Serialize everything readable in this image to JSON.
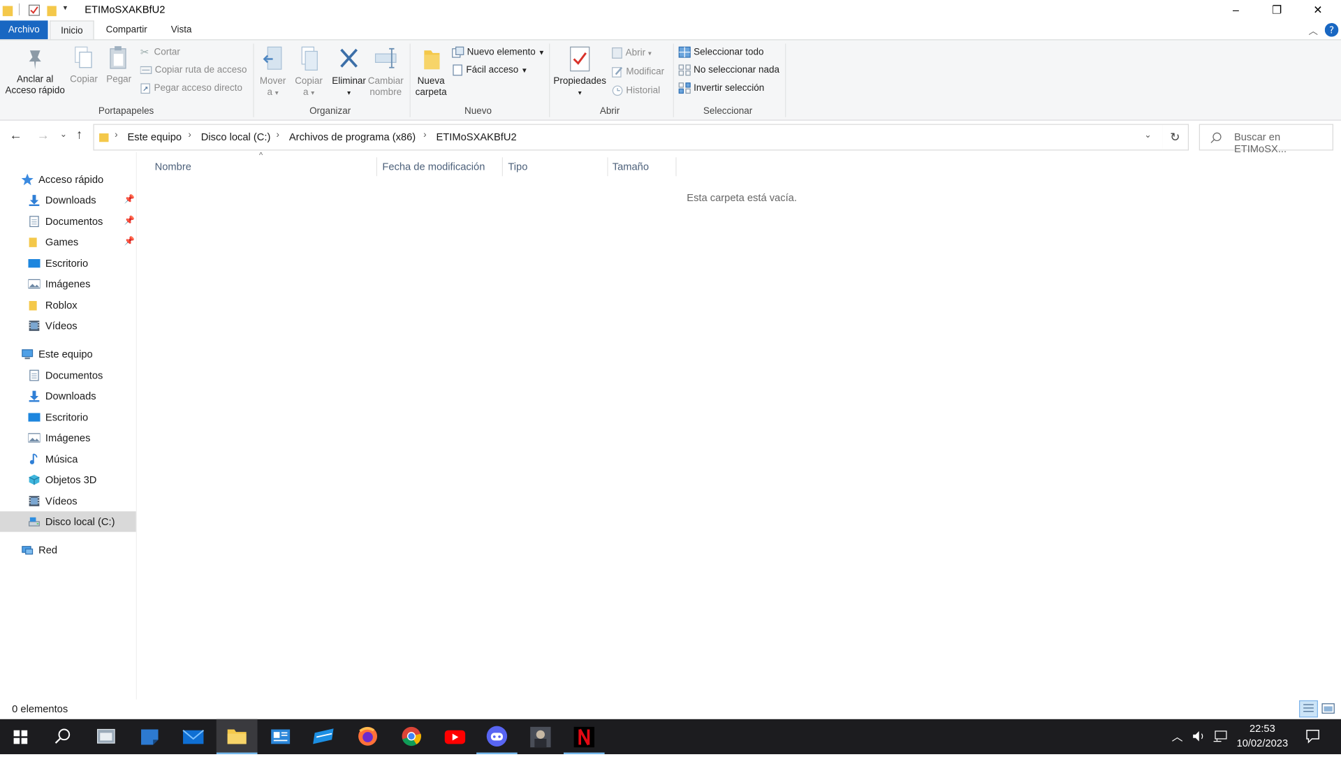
{
  "window": {
    "title": "ETIMoSXAKBfU2",
    "controls": {
      "minimize": "–",
      "maximize": "❐",
      "close": "✕"
    }
  },
  "ribbon": {
    "tabs": [
      {
        "label": "Archivo",
        "kind": "file"
      },
      {
        "label": "Inicio",
        "kind": "active"
      },
      {
        "label": "Compartir",
        "kind": "normal"
      },
      {
        "label": "Vista",
        "kind": "normal"
      }
    ],
    "portapapeles": {
      "group_label": "Portapapeles",
      "pin_line1": "Anclar al",
      "pin_line2": "Acceso rápido",
      "copy": "Copiar",
      "paste": "Pegar",
      "cut": "Cortar",
      "copy_path": "Copiar ruta de acceso",
      "paste_shortcut": "Pegar acceso directo"
    },
    "organizar": {
      "group_label": "Organizar",
      "move_line1": "Mover",
      "move_line2": "a",
      "copyto_line1": "Copiar",
      "copyto_line2": "a",
      "delete": "Eliminar",
      "rename_line1": "Cambiar",
      "rename_line2": "nombre"
    },
    "nuevo": {
      "group_label": "Nuevo",
      "new_folder_line1": "Nueva",
      "new_folder_line2": "carpeta",
      "new_item": "Nuevo elemento",
      "easy_access": "Fácil acceso"
    },
    "abrir": {
      "group_label": "Abrir",
      "properties": "Propiedades",
      "open": "Abrir",
      "edit": "Modificar",
      "history": "Historial"
    },
    "seleccionar": {
      "group_label": "Seleccionar",
      "select_all": "Seleccionar todo",
      "select_none": "No seleccionar nada",
      "invert": "Invertir selección"
    }
  },
  "address": {
    "crumbs": [
      "Este equipo",
      "Disco local (C:)",
      "Archivos de programa (x86)",
      "ETIMoSXAKBfU2"
    ],
    "search_placeholder": "Buscar en ETIMoSX..."
  },
  "nav_pane": {
    "quick_access": {
      "label": "Acceso rápido",
      "items": [
        {
          "label": "Downloads",
          "icon": "download-icon",
          "pinned": true
        },
        {
          "label": "Documentos",
          "icon": "document-icon",
          "pinned": true
        },
        {
          "label": "Games",
          "icon": "folder-icon",
          "pinned": true
        },
        {
          "label": "Escritorio",
          "icon": "desktop-icon",
          "pinned": false
        },
        {
          "label": "Imágenes",
          "icon": "pictures-icon",
          "pinned": false
        },
        {
          "label": "Roblox",
          "icon": "folder-icon",
          "pinned": false
        },
        {
          "label": "Vídeos",
          "icon": "videos-icon",
          "pinned": false
        }
      ]
    },
    "this_pc": {
      "label": "Este equipo",
      "items": [
        {
          "label": "Documentos",
          "icon": "document-icon"
        },
        {
          "label": "Downloads",
          "icon": "download-icon"
        },
        {
          "label": "Escritorio",
          "icon": "desktop-icon"
        },
        {
          "label": "Imágenes",
          "icon": "pictures-icon"
        },
        {
          "label": "Música",
          "icon": "music-icon"
        },
        {
          "label": "Objetos 3D",
          "icon": "3d-objects-icon"
        },
        {
          "label": "Vídeos",
          "icon": "videos-icon"
        },
        {
          "label": "Disco local (C:)",
          "icon": "drive-icon",
          "selected": true
        }
      ]
    },
    "network": {
      "label": "Red"
    }
  },
  "file_list": {
    "columns": [
      "Nombre",
      "Fecha de modificación",
      "Tipo",
      "Tamaño"
    ],
    "empty_message": "Esta carpeta está vacía."
  },
  "status_bar": {
    "item_count": "0 elementos"
  },
  "taskbar": {
    "apps": [
      "start-icon",
      "search-icon",
      "app-icon",
      "app-icon",
      "mail-icon",
      "file-explorer-icon",
      "app-icon",
      "app-icon",
      "firefox-icon",
      "chrome-icon",
      "youtube-icon",
      "discord-icon",
      "game-icon",
      "netflix-icon"
    ],
    "time": "22:53",
    "date": "10/02/2023"
  },
  "colors": {
    "accent": "#1967c2",
    "folder": "#f4c84a",
    "selected_nav": "#d9d9d9",
    "taskbar": "#1c1c1f"
  }
}
